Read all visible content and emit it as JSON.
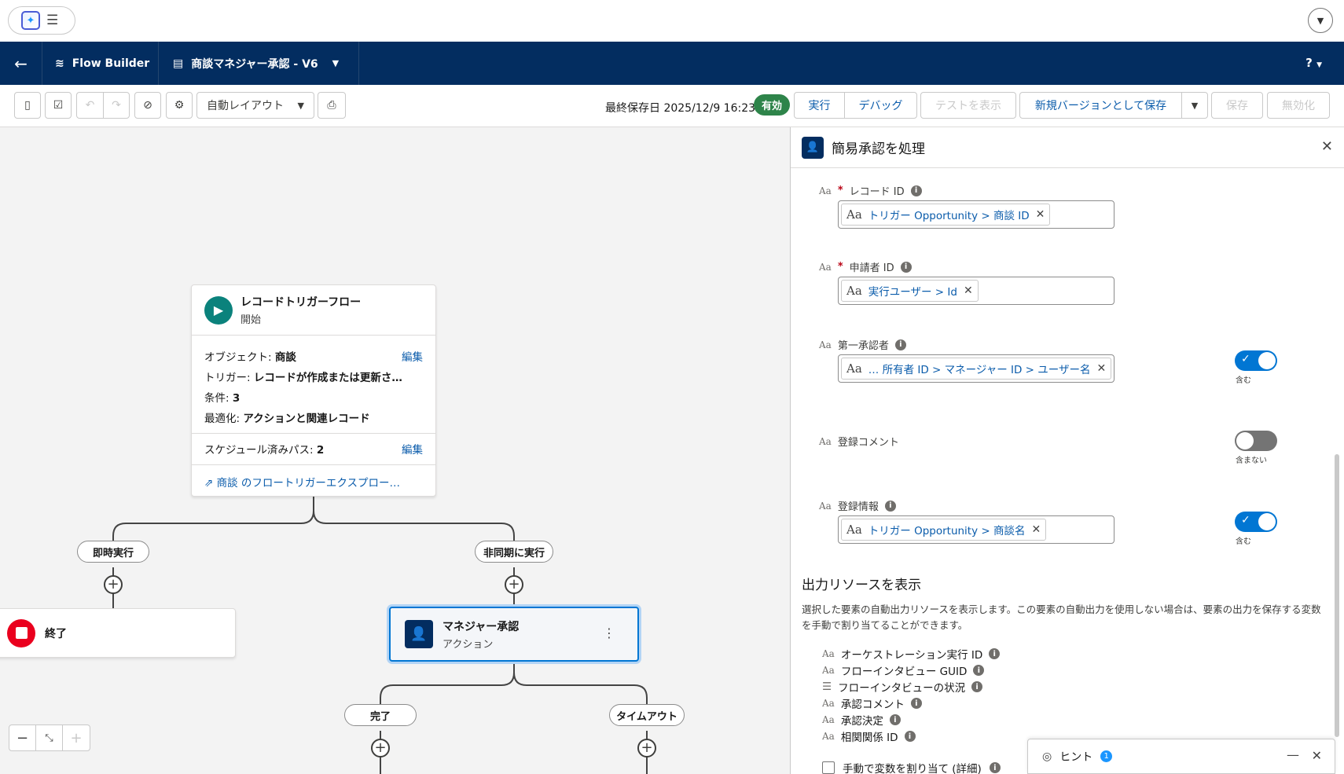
{
  "header": {
    "app": "Flow Builder",
    "flow_name": "商談マネジャー承認 - V6",
    "help": "?"
  },
  "toolbar": {
    "layout_select": "自動レイアウト",
    "saved_text": "最終保存日 2025/12/9 16:23",
    "status": "有効",
    "run": "実行",
    "debug": "デバッグ",
    "view_tests": "テストを表示",
    "save_as_new": "新規バージョンとして保存",
    "save": "保存",
    "deactivate": "無効化"
  },
  "start_card": {
    "title": "レコードトリガーフロー",
    "subtitle": "開始",
    "object_label": "オブジェクト:",
    "object_value": "商談",
    "trigger_label": "トリガー:",
    "trigger_value": "レコードが作成または更新さ…",
    "condition_label": "条件:",
    "condition_value": "3",
    "optimize_label": "最適化:",
    "optimize_value": "アクションと関連レコード",
    "scheduled_label": "スケジュール済みパス:",
    "scheduled_value": "2",
    "edit": "編集",
    "explorer_link": "商談 のフロートリガーエクスプロー…"
  },
  "paths": {
    "immediate": "即時実行",
    "async": "非同期に実行",
    "complete": "完了",
    "timeout": "タイムアウト"
  },
  "end_card": {
    "title": "終了"
  },
  "action_card": {
    "title": "マネジャー承認",
    "subtitle": "アクション"
  },
  "panel": {
    "title": "簡易承認を処理",
    "fields": [
      {
        "label": "レコード ID",
        "required": true,
        "token": "トリガー Opportunity > 商談 ID"
      },
      {
        "label": "申請者 ID",
        "required": true,
        "token": "実行ユーザー > Id"
      },
      {
        "label": "第一承認者",
        "token": "… 所有者 ID > マネージャー ID > ユーザー名",
        "toggle": "含む"
      },
      {
        "label": "登録コメント",
        "toggle": "含まない"
      },
      {
        "label": "登録情報",
        "token": "トリガー Opportunity > 商談名",
        "toggle": "含む"
      }
    ],
    "output_title": "出力リソースを表示",
    "output_desc": "選択した要素の自動出力リソースを表示します。この要素の自動出力を使用しない場合は、要素の出力を保存する変数を手動で割り当てることができます。",
    "outputs": [
      "オーケストレーション実行 ID",
      "フローインタビュー GUID",
      "フローインタビューの状況",
      "承認コメント",
      "承認決定",
      "相関関係 ID"
    ],
    "manual_assign": "手動で変数を割り当て (詳細)"
  },
  "hint": {
    "label": "ヒント",
    "count": "1"
  },
  "colors": {
    "navy": "#032d60",
    "accent": "#0176d3",
    "active": "#2e844a",
    "start": "#0b827c",
    "end": "#ea001e"
  }
}
